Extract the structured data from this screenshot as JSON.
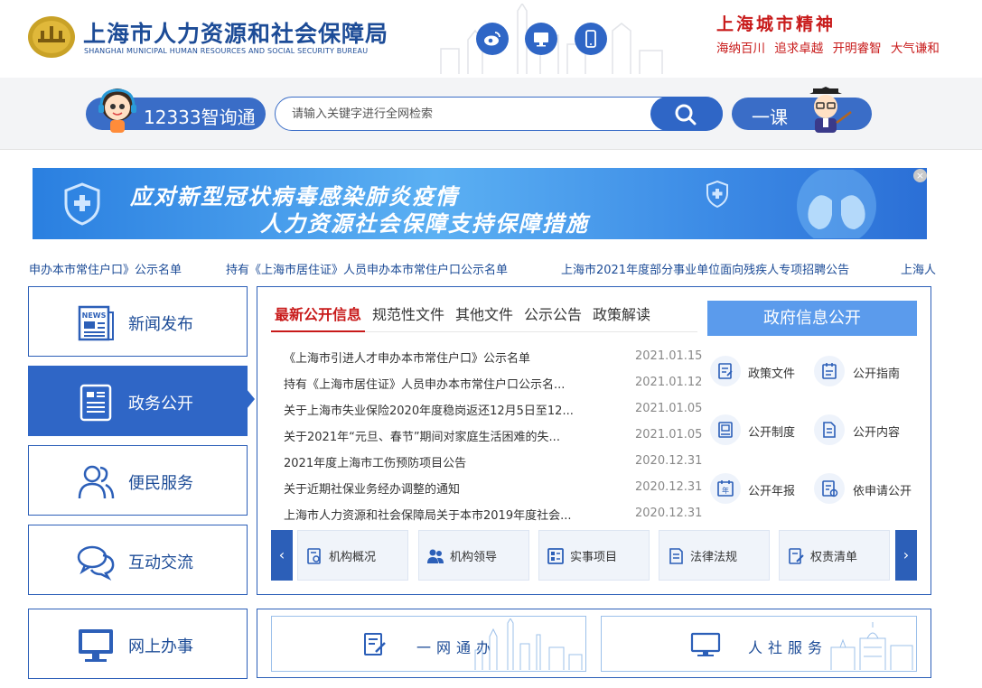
{
  "header": {
    "title": "上海市人力资源和社会保障局",
    "subtitle": "SHANGHAI MUNICIPAL HUMAN RESOURCES AND SOCIAL SECURITY BUREAU",
    "social_icons": [
      "weibo-icon",
      "monitor-icon",
      "mobile-icon"
    ],
    "city_spirit": {
      "title": "上海城市精神",
      "mottos": [
        "海纳百川",
        "追求卓越",
        "开明睿智",
        "大气谦和"
      ]
    }
  },
  "search": {
    "left_pill": "12333智询通",
    "placeholder": "请输入关键字进行全网检索",
    "right_pill": "一课"
  },
  "banner": {
    "line1": "应对新型冠状病毒感染肺炎疫情",
    "line2": "人力资源社会保障支持保障措施",
    "close": "×"
  },
  "ticker": [
    "申办本市常住户口》公示名单",
    "持有《上海市居住证》人员申办本市常住户口公示名单",
    "上海市2021年度部分事业单位面向残疾人专项招聘公告",
    "上海人"
  ],
  "sidebar": {
    "items": [
      {
        "label": "新闻发布",
        "icon": "newspaper-icon"
      },
      {
        "label": "政务公开",
        "icon": "document-icon"
      },
      {
        "label": "便民服务",
        "icon": "people-icon"
      },
      {
        "label": "互动交流",
        "icon": "chat-bubbles-icon"
      },
      {
        "label": "网上办事",
        "icon": "computer-icon"
      }
    ],
    "active_index": 1
  },
  "tabs": [
    "最新公开信息",
    "规范性文件",
    "其他文件",
    "公示公告",
    "政策解读"
  ],
  "news": [
    {
      "title": "《上海市引进人才申办本市常住户口》公示名单",
      "date": "2021.01.15"
    },
    {
      "title": "持有《上海市居住证》人员申办本市常住户口公示名...",
      "date": "2021.01.12"
    },
    {
      "title": "关于上海市失业保险2020年度稳岗返还12月5日至12...",
      "date": "2021.01.05"
    },
    {
      "title": "关于2021年“元旦、春节”期间对家庭生活困难的失...",
      "date": "2021.01.05"
    },
    {
      "title": "2021年度上海市工伤预防项目公告",
      "date": "2020.12.31"
    },
    {
      "title": "关于近期社保业务经办调整的通知",
      "date": "2020.12.31"
    },
    {
      "title": "上海市人力资源和社会保障局关于本市2019年度社会...",
      "date": "2020.12.31"
    }
  ],
  "gov_info": {
    "button": "政府信息公开",
    "links": [
      {
        "label": "政策文件",
        "icon": "policy-file-icon"
      },
      {
        "label": "公开指南",
        "icon": "guide-icon"
      },
      {
        "label": "公开制度",
        "icon": "book-icon"
      },
      {
        "label": "公开内容",
        "icon": "content-icon"
      },
      {
        "label": "公开年报",
        "icon": "annual-report-icon"
      },
      {
        "label": "依申请公开",
        "icon": "apply-icon"
      }
    ]
  },
  "carousel": {
    "prev": "‹",
    "next": "›",
    "items": [
      {
        "label": "机构概况",
        "icon": "org-info-icon"
      },
      {
        "label": "机构领导",
        "icon": "leaders-icon"
      },
      {
        "label": "实事项目",
        "icon": "projects-icon"
      },
      {
        "label": "法律法规",
        "icon": "law-icon"
      },
      {
        "label": "权责清单",
        "icon": "rights-list-icon"
      }
    ]
  },
  "bottom": {
    "one_stop": "一网通办",
    "hr_service": "人社服务"
  },
  "colors": {
    "primary": "#2f66c6",
    "accent_red": "#c81a1a",
    "text_blue": "#1d4c97"
  }
}
